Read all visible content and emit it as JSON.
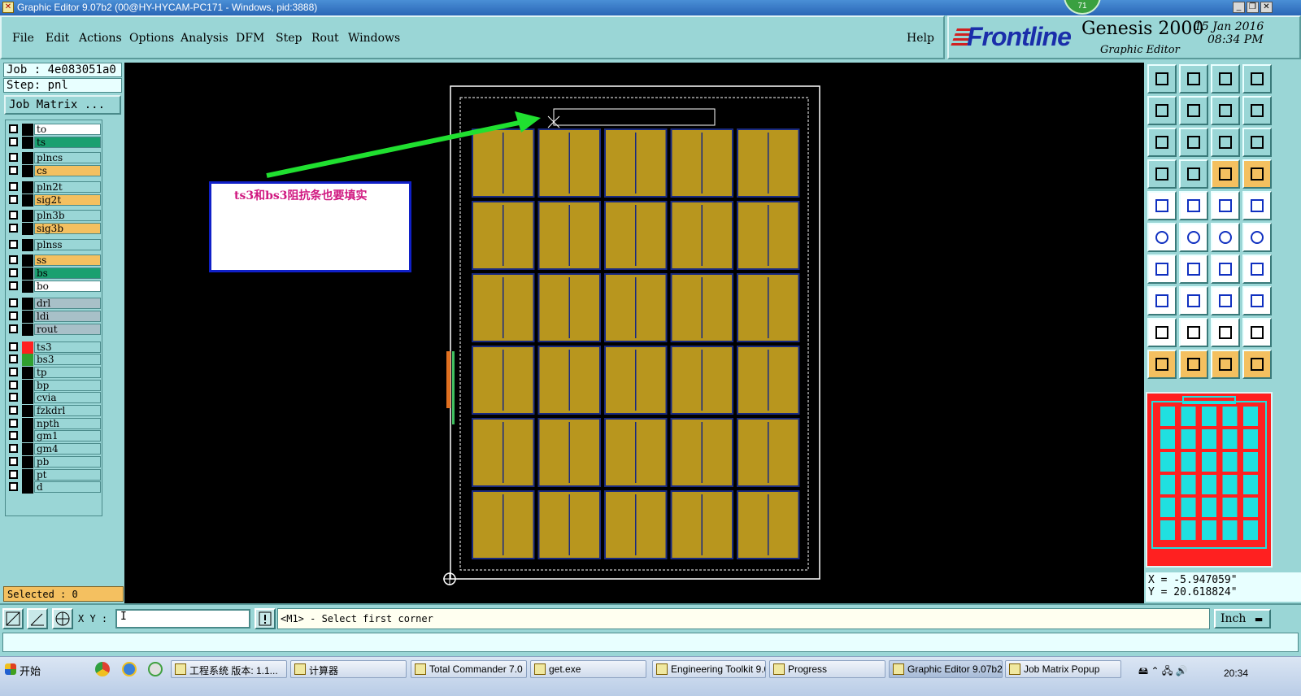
{
  "window": {
    "title": "Graphic Editor 9.07b2 (00@HY-HYCAM-PC171 - Windows, pid:3888)",
    "notification_count": "71"
  },
  "menu": [
    "File",
    "Edit",
    "Actions",
    "Options",
    "Analysis",
    "DFM",
    "Step",
    "Rout",
    "Windows"
  ],
  "help_label": "Help",
  "brand": {
    "logo": "Frontline",
    "product": "Genesis 2000",
    "subtitle": "Graphic Editor",
    "date": "15 Jan 2016",
    "time": "08:34 PM",
    "logo_color": "#1a2eaa"
  },
  "job": {
    "job_label": "Job : 4e083051a0",
    "step_label": "Step: pnl",
    "matrix_button": "Job Matrix ...",
    "selected_label": "Selected : 0"
  },
  "layers": [
    {
      "name": "to",
      "color": "#ffffff"
    },
    {
      "name": "ts",
      "color": "#1aa070"
    },
    {
      "name": "plncs",
      "color": "#9ad6d6"
    },
    {
      "name": "cs",
      "color": "#f4c060"
    },
    {
      "name": "pln2t",
      "color": "#9ad6d6"
    },
    {
      "name": "sig2t",
      "color": "#f4c060"
    },
    {
      "name": "pln3b",
      "color": "#9ad6d6"
    },
    {
      "name": "sig3b",
      "color": "#f4c060"
    },
    {
      "name": "plnss",
      "color": "#9ad6d6"
    },
    {
      "name": "ss",
      "color": "#f4c060"
    },
    {
      "name": "bs",
      "color": "#1aa070"
    },
    {
      "name": "bo",
      "color": "#ffffff"
    },
    {
      "name": "drl",
      "color": "#a8c0c8"
    },
    {
      "name": "ldi",
      "color": "#a8c0c8"
    },
    {
      "name": "rout",
      "color": "#a8c0c8"
    },
    {
      "name": "ts3",
      "color": "#9ad6d6"
    },
    {
      "name": "bs3",
      "color": "#9ad6d6"
    },
    {
      "name": "tp",
      "color": "#9ad6d6"
    },
    {
      "name": "bp",
      "color": "#9ad6d6"
    },
    {
      "name": "cvia",
      "color": "#9ad6d6"
    },
    {
      "name": "fzkdrl",
      "color": "#9ad6d6"
    },
    {
      "name": "npth",
      "color": "#9ad6d6"
    },
    {
      "name": "gm1",
      "color": "#9ad6d6"
    },
    {
      "name": "gm4",
      "color": "#9ad6d6"
    },
    {
      "name": "pb",
      "color": "#9ad6d6"
    },
    {
      "name": "pt",
      "color": "#9ad6d6"
    },
    {
      "name": "d",
      "color": "#9ad6d6"
    }
  ],
  "annotation": {
    "text": "ts3和bs3阻抗条也要填实",
    "text_color": "#d01880",
    "arrow_color": "#20e030"
  },
  "board": {
    "rows": 6,
    "cols": 5,
    "unit_color": "#b8961e"
  },
  "coords": {
    "x_label": "X = -5.947059\"",
    "y_label": "Y = 20.618824\""
  },
  "command": {
    "xy_label": "X Y :",
    "xy_value": "I",
    "prompt": "<M1> - Select first corner",
    "units": "Inch"
  },
  "taskbar": {
    "start": "开始",
    "tasks": [
      "工程系统  版本: 1.1...",
      "计算器",
      "Total Commander 7.0 ...",
      "get.exe",
      "Engineering Toolkit 9.0...",
      "Progress",
      "Graphic Editor 9.07b2 ...",
      "Job Matrix Popup"
    ],
    "clock": "20:34"
  }
}
